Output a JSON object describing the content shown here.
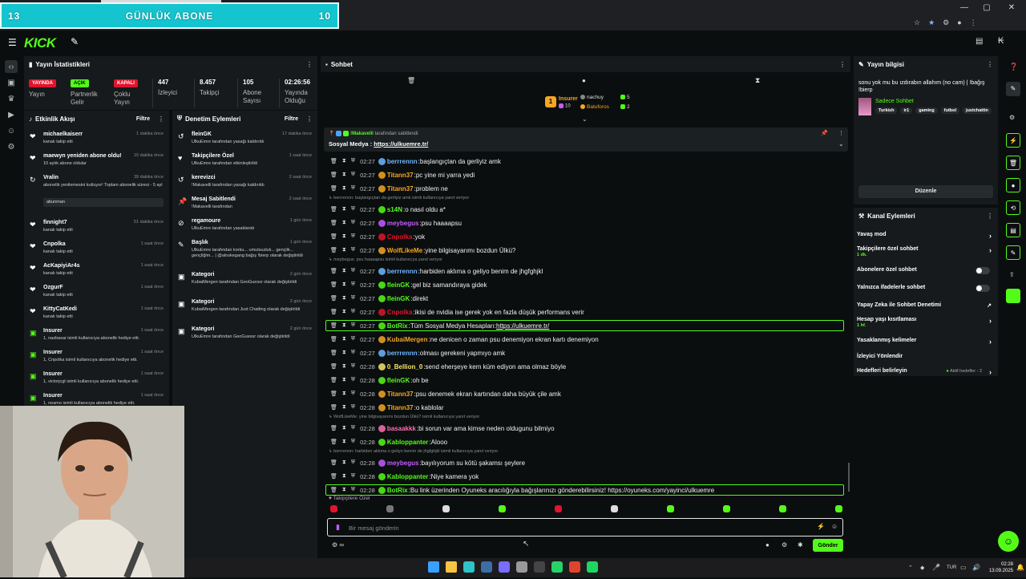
{
  "overlay": {
    "left_num": "13",
    "title": "GÜNLÜK ABONE",
    "right_num": "10"
  },
  "nav": {
    "logo": "KICK"
  },
  "stats": {
    "title": "Yayın İstatistikleri",
    "badges": [
      {
        "text": "YAYINDA",
        "label": "Yayın",
        "color": "#e0142c"
      },
      {
        "text": "AÇIK",
        "label": "Partnerlik Gelir",
        "color": "#53fc18"
      },
      {
        "text": "KAPALI",
        "label": "Çoklu Yayın",
        "color": "#e0142c"
      }
    ],
    "values": [
      {
        "v": "447",
        "l": "İzleyici"
      },
      {
        "v": "8.457",
        "l": "Takipçi"
      },
      {
        "v": "105",
        "l": "Abone Sayısı"
      },
      {
        "v": "02:26:56",
        "l": "Yayında Olduğu"
      }
    ]
  },
  "activity": {
    "title": "Etkinlik Akışı",
    "filter": "Filtre",
    "items": [
      {
        "t": "michaelkaiserr",
        "tm": "1 dakika önce",
        "d": "kanalı takip etti",
        "icon": "heart"
      },
      {
        "t": "maewyn yeniden abone oldu!",
        "tm": "15 dakika önce",
        "d": "10 aylık abone oldular",
        "icon": "heart"
      },
      {
        "t": "Vralin",
        "tm": "39 dakika önce",
        "d": "abonelik yenilemesini kutluyor! Toplam abonelik süresi - 5 ayl",
        "icon": "star",
        "extra": "abunman"
      },
      {
        "t": "finnight7",
        "tm": "51 dakika önce",
        "d": "kanalı takip etti",
        "icon": "heart"
      },
      {
        "t": "Cnpolka",
        "tm": "1 saat önce",
        "d": "kanalı takip etti",
        "icon": "heart"
      },
      {
        "t": "AcKapiyiAr4s",
        "tm": "1 saat önce",
        "d": "kanalı takip etti",
        "icon": "heart"
      },
      {
        "t": "OzgurF",
        "tm": "1 saat önce",
        "d": "kanalı takip etti",
        "icon": "heart"
      },
      {
        "t": "KittyCatKedi",
        "tm": "1 saat önce",
        "d": "kanalı takip etti",
        "icon": "heart"
      },
      {
        "t": "Insurer",
        "tm": "1 saat önce",
        "d": "1, nazbasar isimli kullanıcıya abonelik hediye etti.",
        "icon": "gift"
      },
      {
        "t": "Insurer",
        "tm": "1 saat önce",
        "d": "1, Cnpolka isimli kullanıcıya abonelik hediye etti.",
        "icon": "gift"
      },
      {
        "t": "Insurer",
        "tm": "1 saat önce",
        "d": "1, victorjcgt isimli kullanıcıya abonelik hediye etti.",
        "icon": "gift"
      },
      {
        "t": "Insurer",
        "tm": "1 saat önce",
        "d": "1, neamo isimli kullanıcıya abonelik hediye etti.",
        "icon": "gift"
      }
    ]
  },
  "modlog": {
    "title": "Denetim Eylemleri",
    "filter": "Filtre",
    "items": [
      {
        "t": "fleinGK",
        "tm": "17 dakika önce",
        "d": "UlkuEmre tarafından yasağı kaldırıldı"
      },
      {
        "t": "Takipçilere Özel",
        "tm": "1 saat önce",
        "d": "UlkuEmre tarafından etkinleştirildi"
      },
      {
        "t": "kerevizci",
        "tm": "2 saat önce",
        "d": "!Makavelli tarafından yasağı kaldırıldı"
      },
      {
        "t": "Mesaj Sabitlendi",
        "tm": "2 saat önce",
        "d": "!Makavelli tarafından"
      },
      {
        "t": "regamoure",
        "tm": "1 gün önce",
        "d": "UlkuEmre tarafından yasaklandı"
      },
      {
        "t": "Başlık",
        "tm": "1 gün önce",
        "d": "UlkuEmre tarafından korku... umutsuzluk... gençlik... gençliğim... | @aloskegang bağış !bierp olarak değiştirildi"
      },
      {
        "t": "Kategori",
        "tm": "2 gün önce",
        "d": "KubaiMergen tarafından GeoGuessr olarak değiştirildi"
      },
      {
        "t": "Kategori",
        "tm": "2 gün önce",
        "d": "KubaiMergen tarafından Just Chatting olarak değiştirildi"
      },
      {
        "t": "Kategori",
        "tm": "2 gün önce",
        "d": "UlkuEmre tarafından GeoGuessr olarak değiştirildi"
      }
    ]
  },
  "chat": {
    "title": "Sohbet",
    "top_gifters": [
      {
        "name": "Insurer",
        "n": "10"
      },
      {
        "name": "nachuy",
        "n": "5"
      },
      {
        "name": "Batuforos",
        "n": "2"
      }
    ],
    "pinned": {
      "user": "!Makavelli",
      "by": "tarafından sabitlendi",
      "label": "Sosyal Medya :",
      "link": "https://ulkuemre.tr/"
    },
    "messages": [
      {
        "tm": "02:27",
        "u": "berrrennn",
        "c": "#6fb6ff",
        "tx": "başlangıçtan da gerliyiz amk"
      },
      {
        "tm": "02:27",
        "u": "Titann37",
        "c": "#f5a623",
        "tx": "pc yine mi yarra yedi"
      },
      {
        "tm": "02:27",
        "u": "Titann37",
        "c": "#f5a623",
        "tx": "problem ne"
      },
      {
        "reply": "berrrennn: başlangıçtan da gerliyiz amk isimli kullanıcıya yanıt veriyor"
      },
      {
        "tm": "02:27",
        "u": "s14N",
        "c": "#53fc18",
        "tx": "o nasıl oldu a*"
      },
      {
        "tm": "02:27",
        "u": "meybegus",
        "c": "#c45cff",
        "tx": "psu haaaapsu"
      },
      {
        "tm": "02:27",
        "u": "Cnpolka",
        "c": "#e0142c",
        "tx": "yok"
      },
      {
        "tm": "02:27",
        "u": "WolfLikeMe",
        "c": "#f5a623",
        "tx": "yine bilgisayarımı bozdun Ülkü?"
      },
      {
        "reply": "meybegus: psu haaaapsu isimli kullanıcıya yanıt veriyor"
      },
      {
        "tm": "02:27",
        "u": "berrrennn",
        "c": "#6fb6ff",
        "tx": "harbiden aklıma o geliyo benim de jhgfghjkl"
      },
      {
        "tm": "02:27",
        "u": "fleinGK",
        "c": "#53fc18",
        "tx": "gel biz samandıraya gidek"
      },
      {
        "tm": "02:27",
        "u": "fleinGK",
        "c": "#53fc18",
        "tx": "direkt"
      },
      {
        "tm": "02:27",
        "u": "Cnpolka",
        "c": "#e0142c",
        "tx": "ikisi de nvidia ise gerek yok en fazla düşük performans verir"
      },
      {
        "tm": "02:27",
        "u": "BotRix",
        "c": "#53fc18",
        "tx": "Tüm Sosyal Medya Hesapları:",
        "link": "https://ulkuemre.tr/",
        "bot": true
      },
      {
        "tm": "02:27",
        "u": "KubaiMergen",
        "c": "#f5a623",
        "tx": "ne denicen o zaman psu denemiyon ekran kartı denemiyon"
      },
      {
        "tm": "02:27",
        "u": "berrrennn",
        "c": "#6fb6ff",
        "tx": "olması gerekeni yapmıyo amk"
      },
      {
        "tm": "02:28",
        "u": "0_Bellion_0",
        "c": "#f5e663",
        "tx": "send eherşeye kem küm ediyon ama olmaz böyle"
      },
      {
        "tm": "02:28",
        "u": "fleinGK",
        "c": "#53fc18",
        "tx": "oh be"
      },
      {
        "tm": "02:28",
        "u": "Titann37",
        "c": "#f5a623",
        "tx": "psu denemek ekran kartından daha büyük çile amk"
      },
      {
        "tm": "02:28",
        "u": "Titann37",
        "c": "#f5a623",
        "tx": "o kablolar"
      },
      {
        "reply": "WolfLikeMe: yine bilgisayarımı bozdun Ülkü? isimli kullanıcıya yanıt veriyor"
      },
      {
        "tm": "02:28",
        "u": "basaakkk",
        "c": "#ff6fb0",
        "tx": "bi sorun var ama kimse neden oldugunu bilmiyo"
      },
      {
        "tm": "02:28",
        "u": "Kabloppanter",
        "c": "#53fc18",
        "tx": "Alooo"
      },
      {
        "reply": "berrrennn: harbiden aklıma o geliyo benim de jhgfghjkl isimli kullanıcıya yanıt veriyor"
      },
      {
        "tm": "02:28",
        "u": "meybegus",
        "c": "#c45cff",
        "tx": "bayılıyorum su kötü şakamsı şeylere"
      },
      {
        "tm": "02:28",
        "u": "Kabloppanter",
        "c": "#53fc18",
        "tx": "Niye kamera yok"
      },
      {
        "tm": "02:28",
        "u": "BotRix",
        "c": "#53fc18",
        "tx": "Bu link üzerinden Oyuneks aracılığıyla bağışlarınızı gönderebilirsiniz! https://oyuneks.com/yayinci/ulkuemre",
        "bot": true
      }
    ],
    "mode": "Takipçilere Özel",
    "placeholder": "Bir mesaj gönderin",
    "send": "Gönder",
    "points": "∞"
  },
  "info": {
    "title": "Yayın bilgisi",
    "stream_title": "sonu yok mu bu ızdırabın allahım (no cam) | !bağış !bierp",
    "category": "Sadece Sohbet",
    "tags": [
      "Turkish",
      "ir1",
      "gaming",
      "futbol",
      "justchattin"
    ],
    "edit": "Düzenle"
  },
  "actions": {
    "title": "Kanal Eylemleri",
    "rows": [
      {
        "label": "Yavaş mod",
        "type": "chevron"
      },
      {
        "label": "Takipçilere özel sohbet",
        "sub": "1 dk.",
        "type": "chevron"
      },
      {
        "label": "Abonelere özel sohbet",
        "type": "toggle"
      },
      {
        "label": "Yalnızca ifadelerle sohbet",
        "type": "toggle"
      },
      {
        "label": "Yapay Zeka ile Sohbet Denetimi",
        "type": "ext"
      },
      {
        "label": "Hesap yaşı kısıtlaması",
        "sub": "1 hf.",
        "type": "chevron"
      },
      {
        "label": "Yasaklanmış kelimeler",
        "type": "chevron"
      },
      {
        "label": "İzleyici Yönlendir",
        "type": "none"
      },
      {
        "label": "Hedefleri belirleyin",
        "side": "Aktif hedefler - 2",
        "type": "chevron"
      }
    ]
  },
  "taskbar": {
    "lang": "TUR",
    "time": "02:28",
    "date": "13.09.2025"
  }
}
